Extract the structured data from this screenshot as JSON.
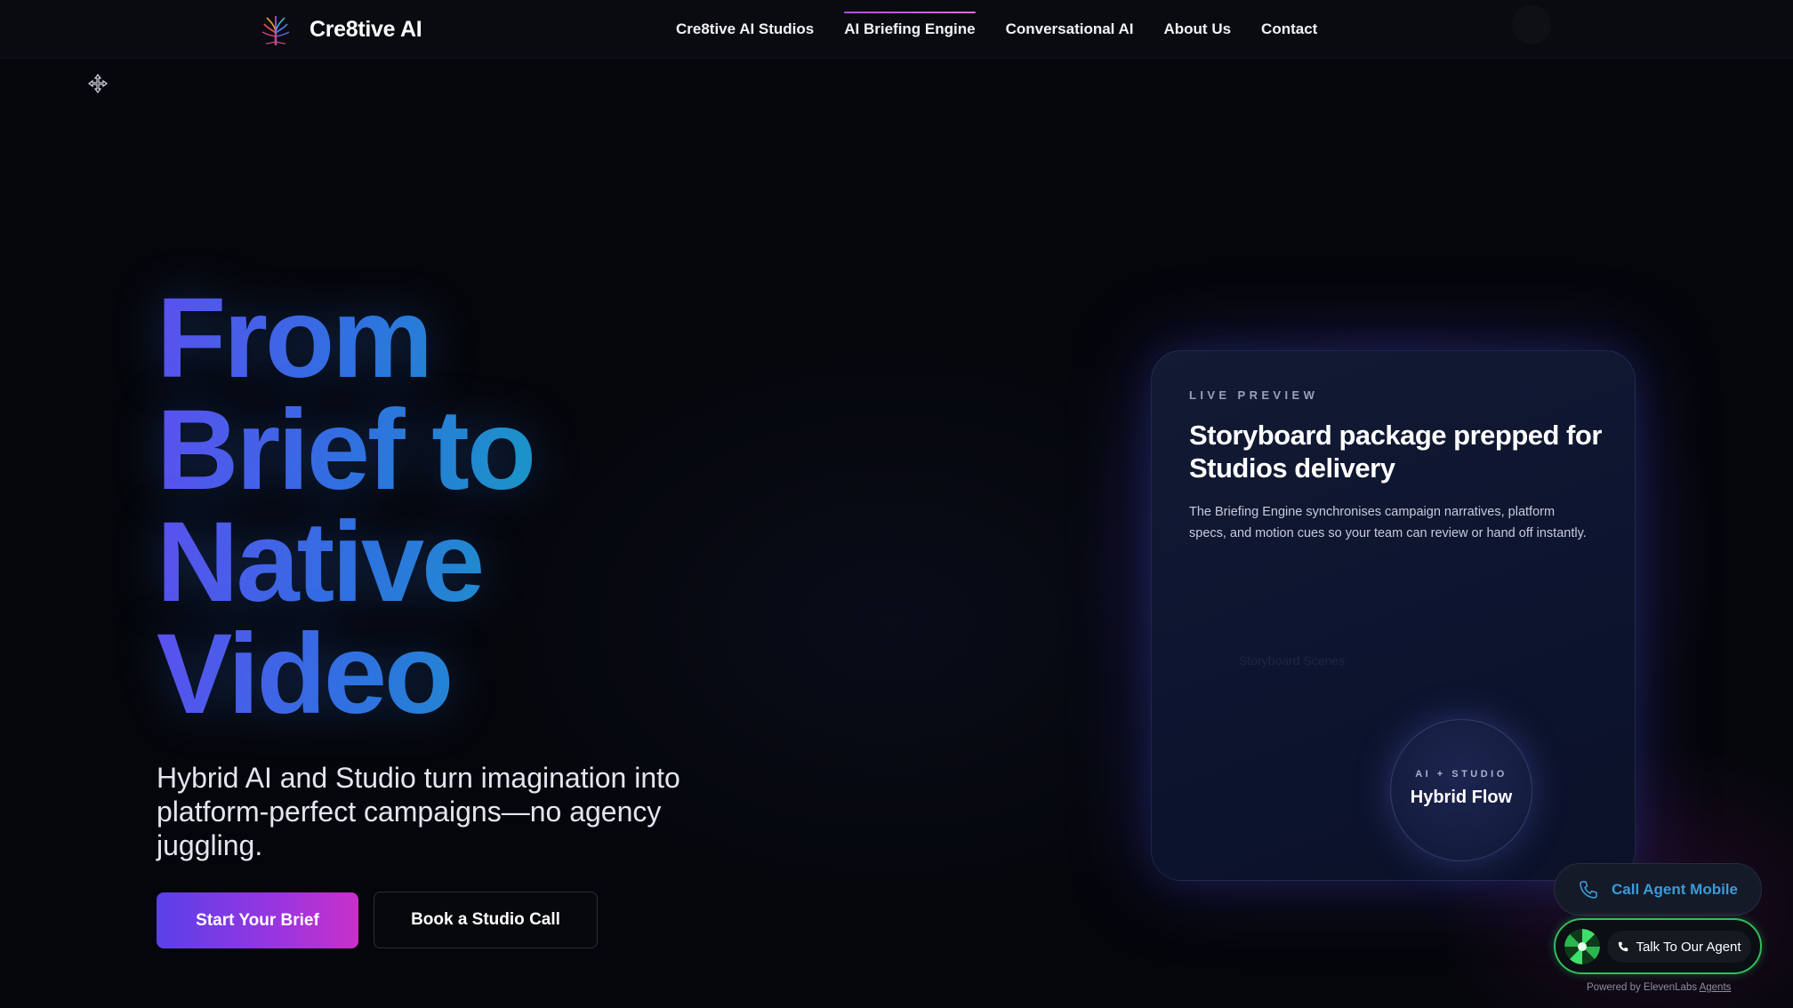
{
  "header": {
    "brand_name": "Cre8tive AI",
    "nav": [
      {
        "label": "Cre8tive AI Studios",
        "active": false
      },
      {
        "label": "AI Briefing Engine",
        "active": true
      },
      {
        "label": "Conversational AI",
        "active": false
      },
      {
        "label": "About Us",
        "active": false
      },
      {
        "label": "Contact",
        "active": false
      }
    ]
  },
  "hero": {
    "title_lines": [
      "From",
      "Brief to",
      "Native",
      "Video"
    ],
    "subtitle": "Hybrid AI and Studio turn imagination into platform-perfect campaigns—no agency juggling.",
    "primary_cta": "Start Your Brief",
    "secondary_cta": "Book a Studio Call"
  },
  "preview_card": {
    "eyebrow": "LIVE PREVIEW",
    "title": "Storyboard package prepped for Studios delivery",
    "body": "The Briefing Engine synchronises campaign narratives, platform specs, and motion cues so your team can review or hand off instantly.",
    "ghost_label": "Storyboard Scenes",
    "orb": {
      "eyebrow": "AI + STUDIO",
      "label": "Hybrid Flow"
    }
  },
  "widgets": {
    "call_mobile": "Call Agent Mobile",
    "talk_agent": "Talk To Our Agent",
    "powered_prefix": "Powered by ElevenLabs",
    "powered_link": "Agents"
  },
  "icons": {
    "brand": "tree-logo-icon",
    "cursor": "move-cursor-icon",
    "phone": "phone-icon"
  },
  "colors": {
    "background": "#05060b",
    "primary_gradient_start": "#5a40e8",
    "primary_gradient_end": "#c930c8",
    "link_blue": "#3a9bd8",
    "agent_green": "#2fbf5a"
  }
}
